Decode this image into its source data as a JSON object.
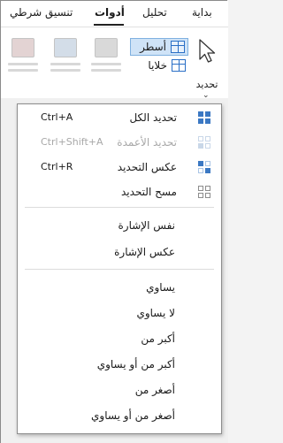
{
  "tabs": [
    {
      "label": "بداية",
      "active": false
    },
    {
      "label": "تحليل",
      "active": false
    },
    {
      "label": "أدوات",
      "active": true
    },
    {
      "label": "تنسيق شرطي",
      "active": false
    }
  ],
  "ribbon": {
    "select_label": "تحديد",
    "rows_label": "أسطر",
    "cells_label": "خلايا"
  },
  "menu": {
    "items": [
      {
        "label": "تحديد الكل",
        "shortcut": "Ctrl+A",
        "icon": "grid-full-icon",
        "enabled": true
      },
      {
        "label": "تحديد الأعمدة",
        "shortcut": "Ctrl+Shift+A",
        "icon": "grid-columns-icon",
        "enabled": false
      },
      {
        "label": "عكس التحديد",
        "shortcut": "Ctrl+R",
        "icon": "grid-invert-icon",
        "enabled": true
      },
      {
        "label": "مسح التحديد",
        "shortcut": "",
        "icon": "grid-clear-icon",
        "enabled": true
      },
      {
        "label": "نفس الإشارة",
        "shortcut": "",
        "icon": "",
        "enabled": true
      },
      {
        "label": "عكس الإشارة",
        "shortcut": "",
        "icon": "",
        "enabled": true
      },
      {
        "label": "يساوي",
        "shortcut": "",
        "icon": "",
        "enabled": true
      },
      {
        "label": "لا يساوي",
        "shortcut": "",
        "icon": "",
        "enabled": true
      },
      {
        "label": "أكبر من",
        "shortcut": "",
        "icon": "",
        "enabled": true
      },
      {
        "label": "أكبر من أو يساوي",
        "shortcut": "",
        "icon": "",
        "enabled": true
      },
      {
        "label": "أصغر من",
        "shortcut": "",
        "icon": "",
        "enabled": true
      },
      {
        "label": "أصغر من أو يساوي",
        "shortcut": "",
        "icon": "",
        "enabled": true
      }
    ]
  },
  "colors": {
    "accent": "#2a6fc6",
    "selected_fill": "#cfe3f7",
    "icon_blue": "#3b78c3",
    "icon_light": "#a9c5e6",
    "icon_disabled": "#c9d7e8"
  }
}
